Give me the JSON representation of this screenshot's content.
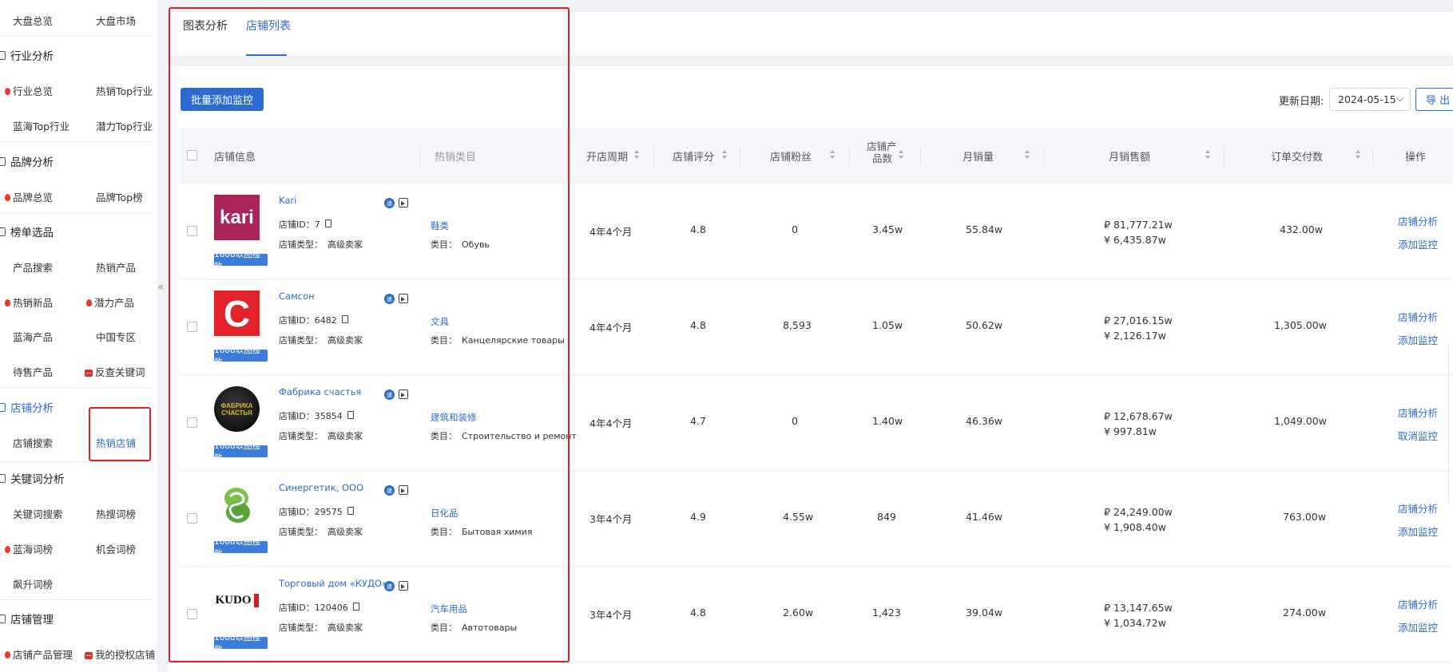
{
  "sidebar": {
    "top_items": [
      "大盘总览",
      "大盘市场"
    ],
    "groups": [
      {
        "label": "行业分析",
        "items": [
          {
            "label": "行业总览",
            "mark": "fire"
          },
          {
            "label": "热销Top行业"
          },
          {
            "label": "蓝海Top行业"
          },
          {
            "label": "潜力Top行业"
          }
        ]
      },
      {
        "label": "品牌分析",
        "items": [
          {
            "label": "品牌总览",
            "mark": "fire"
          },
          {
            "label": "品牌Top榜"
          }
        ]
      },
      {
        "label": "榜单选品",
        "items": [
          {
            "label": "产品搜索"
          },
          {
            "label": "热销产品"
          },
          {
            "label": "热销新品",
            "mark": "fire"
          },
          {
            "label": "潜力产品",
            "mark": "fire"
          },
          {
            "label": "蓝海产品"
          },
          {
            "label": "中国专区"
          },
          {
            "label": "待售产品"
          },
          {
            "label": "反查关键词",
            "mark": "box"
          }
        ]
      },
      {
        "label": "店铺分析",
        "items": [
          {
            "label": "店铺搜索"
          },
          {
            "label": "热销店铺"
          }
        ]
      },
      {
        "label": "关键词分析",
        "items": [
          {
            "label": "关键词搜索"
          },
          {
            "label": "热搜词榜"
          },
          {
            "label": "蓝海词榜",
            "mark": "fire"
          },
          {
            "label": "机会词榜"
          },
          {
            "label": "飙升词榜"
          }
        ]
      },
      {
        "label": "店铺管理",
        "items": [
          {
            "label": "店铺产品管理",
            "mark": "fire"
          },
          {
            "label": "我的授权店铺",
            "mark": "box"
          }
        ]
      }
    ]
  },
  "tabs": [
    "图表分析",
    "店铺列表"
  ],
  "toolbar": {
    "batch_button": "批量添加监控",
    "date_label": "更新日期:",
    "date_value": "2024-05-15",
    "export_button": "导 出"
  },
  "table": {
    "headers": [
      "店铺信息",
      "热销类目",
      "开店周期",
      "店铺评分",
      "店铺粉丝",
      "店铺产",
      "品数",
      "月销量",
      "月销售额",
      "订单交付数",
      "操作"
    ],
    "id_label": "店铺ID：",
    "type_label": "店铺类型：",
    "cat_label": "类目：",
    "badge": "1688以图搜款",
    "icon_letter": "速",
    "rows": [
      {
        "name": "Kari",
        "id": "7",
        "type": "高级卖家",
        "cat": "鞋类",
        "catsub": "Обувь",
        "period": "4年4个月",
        "rating": "4.8",
        "fans": "0",
        "products": "3.45w",
        "sales": "55.84w",
        "rub": "₽ 81,777.21w",
        "cny": "¥ 6,435.87w",
        "orders": "432.00w",
        "op1": "店铺分析",
        "op2": "添加监控",
        "logo_text": "kari"
      },
      {
        "name": "Самсон",
        "id": "6482",
        "type": "高级卖家",
        "cat": "文具",
        "catsub": "Канцелярские товары",
        "period": "4年4个月",
        "rating": "4.8",
        "fans": "8,593",
        "products": "1.05w",
        "sales": "50.62w",
        "rub": "₽ 27,016.15w",
        "cny": "¥ 2,126.17w",
        "orders": "1,305.00w",
        "op1": "店铺分析",
        "op2": "添加监控",
        "logo_text": "C"
      },
      {
        "name": "Фабрика счастья",
        "id": "35854",
        "type": "高级卖家",
        "cat": "建筑和装修",
        "catsub": "Строительство и ремонт",
        "period": "4年4个月",
        "rating": "4.7",
        "fans": "0",
        "products": "1.40w",
        "sales": "46.36w",
        "rub": "₽ 12,678.67w",
        "cny": "¥ 997.81w",
        "orders": "1,049.00w",
        "op1": "店铺分析",
        "op2": "取消监控",
        "logo_text": "ФАБРИКА СЧАСТЬЯ"
      },
      {
        "name": "Синергетик, ООО",
        "id": "29575",
        "type": "高级卖家",
        "cat": "日化品",
        "catsub": "Бытовая химия",
        "period": "3年4个月",
        "rating": "4.9",
        "fans": "4.55w",
        "products": "849",
        "sales": "41.46w",
        "rub": "₽ 24,249.00w",
        "cny": "¥ 1,908.40w",
        "orders": "763.00w",
        "op1": "店铺分析",
        "op2": "添加监控",
        "logo_text": ""
      },
      {
        "name": "Торговый дом «КУДО»",
        "id": "120406",
        "type": "高级卖家",
        "cat": "汽车用品",
        "catsub": "Автотовары",
        "period": "3年4个月",
        "rating": "4.8",
        "fans": "2.60w",
        "products": "1,423",
        "sales": "39.04w",
        "rub": "₽ 13,147.65w",
        "cny": "¥ 1,034.72w",
        "orders": "274.00w",
        "op1": "店铺分析",
        "op2": "添加监控",
        "logo_text": "KUDO"
      }
    ]
  },
  "colors": {
    "accent": "#2d6bd1",
    "highlight": "#e02020",
    "fire": "#e83a2f",
    "kari": "#a8245a",
    "samson": "#e3212b"
  }
}
